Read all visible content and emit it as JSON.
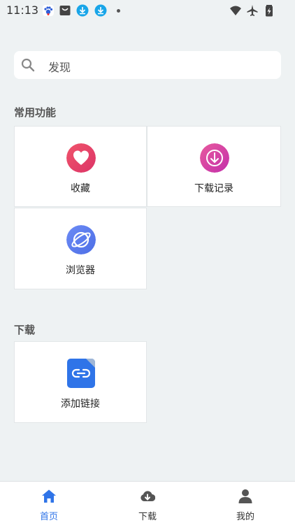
{
  "status_bar": {
    "time": "11:13"
  },
  "search": {
    "placeholder": "发现"
  },
  "sections": {
    "common": {
      "title": "常用功能",
      "items": [
        {
          "label": "收藏",
          "icon": "heart-icon",
          "color": "#e8436b"
        },
        {
          "label": "下载记录",
          "icon": "download-arrow-icon",
          "color": "#e63a8f"
        },
        {
          "label": "浏览器",
          "icon": "planet-icon",
          "color": "#5b7ef2"
        }
      ]
    },
    "download": {
      "title": "下载",
      "items": [
        {
          "label": "添加链接",
          "icon": "link-file-icon",
          "color": "#2f74e8"
        }
      ]
    }
  },
  "bottom_nav": {
    "items": [
      {
        "label": "首页",
        "icon": "home-icon",
        "active": true
      },
      {
        "label": "下载",
        "icon": "cloud-download-icon",
        "active": false
      },
      {
        "label": "我的",
        "icon": "user-icon",
        "active": false
      }
    ],
    "active_color": "#2f74e8"
  }
}
